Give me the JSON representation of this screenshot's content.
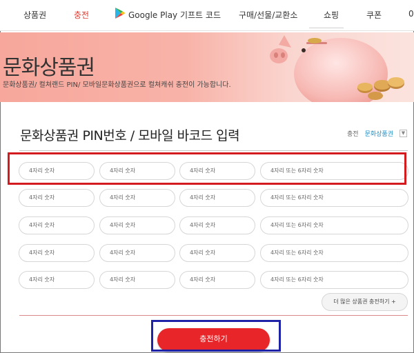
{
  "nav": {
    "items": [
      "상품권",
      "충전",
      "Google Play 기프트 코드",
      "구매/선물/교환소",
      "쇼핑",
      "쿠폰",
      "0"
    ],
    "active_index": 1,
    "accent": "#e03c31"
  },
  "banner": {
    "title": "문화상품권",
    "subtitle": "문화상품권/ 컬쳐랜드 PIN/ 모바일문화상품권으로 컬쳐캐쉬 충전이 가능합니다."
  },
  "section": {
    "title": "문화상품권 PIN번호 / 모바일 바코드 입력",
    "crumb_label": "충전",
    "crumb_select": "문화상품권",
    "crumb_icon": "chevron-down-icon"
  },
  "pin_grid": {
    "placeholder_short": "4자리 숫자",
    "placeholder_long": "4자리 또는 6자리 숫자",
    "row_count": 5
  },
  "more_button": "더 많은 상품권 충전하기 +",
  "charge_button": "충전하기",
  "colors": {
    "highlight_red": "#d31a1e",
    "highlight_blue": "#1d22a7",
    "charge": "#e8262a",
    "link": "#1f8fc6"
  }
}
